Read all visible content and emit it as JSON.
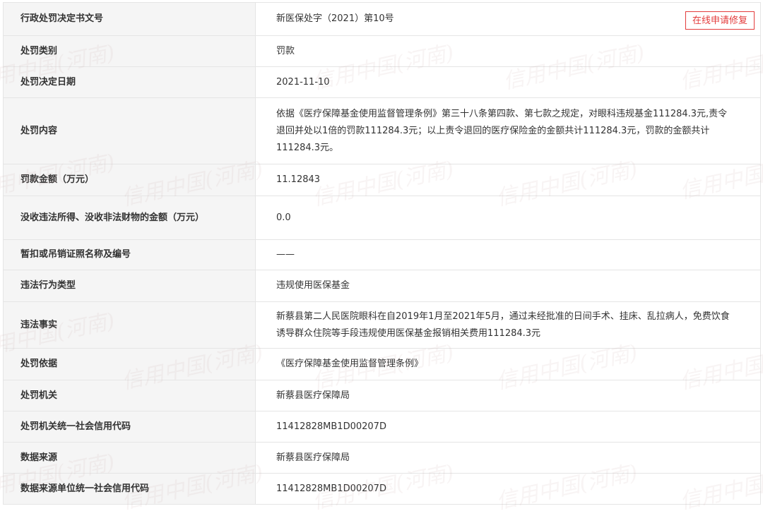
{
  "repair_button": "在线申请修复",
  "watermark_text": "信用中国(河南)",
  "rows": [
    {
      "label": "行政处罚决定书文号",
      "value": "新医保处字（2021）第10号"
    },
    {
      "label": "处罚类别",
      "value": "罚款"
    },
    {
      "label": "处罚决定日期",
      "value": "2021-11-10"
    },
    {
      "label": "处罚内容",
      "value": "依据《医疗保障基金使用监督管理条例》第三十八条第四款、第七款之规定，对眼科违规基金111284.3元,责令退回并处以1倍的罚款111284.3元；以上责令退回的医疗保险金的金额共计111284.3元，罚款的金额共计111284.3元。"
    },
    {
      "label": "罚款金额（万元）",
      "value": "11.12843"
    },
    {
      "label": "没收违法所得、没收非法财物的金额（万元）",
      "value": "0.0"
    },
    {
      "label": "暂扣或吊销证照名称及编号",
      "value": "——"
    },
    {
      "label": "违法行为类型",
      "value": "违规使用医保基金"
    },
    {
      "label": "违法事实",
      "value": "新蔡县第二人民医院眼科在自2019年1月至2021年5月，通过未经批准的日间手术、挂床、乱拉病人，免费饮食诱导群众住院等手段违规使用医保基金报销相关费用111284.3元"
    },
    {
      "label": "处罚依据",
      "value": "《医疗保障基金使用监督管理条例》"
    },
    {
      "label": "处罚机关",
      "value": "新蔡县医疗保障局"
    },
    {
      "label": "处罚机关统一社会信用代码",
      "value": "11412828MB1D00207D"
    },
    {
      "label": "数据来源",
      "value": "新蔡县医疗保障局"
    },
    {
      "label": "数据来源单位统一社会信用代码",
      "value": "11412828MB1D00207D"
    }
  ]
}
